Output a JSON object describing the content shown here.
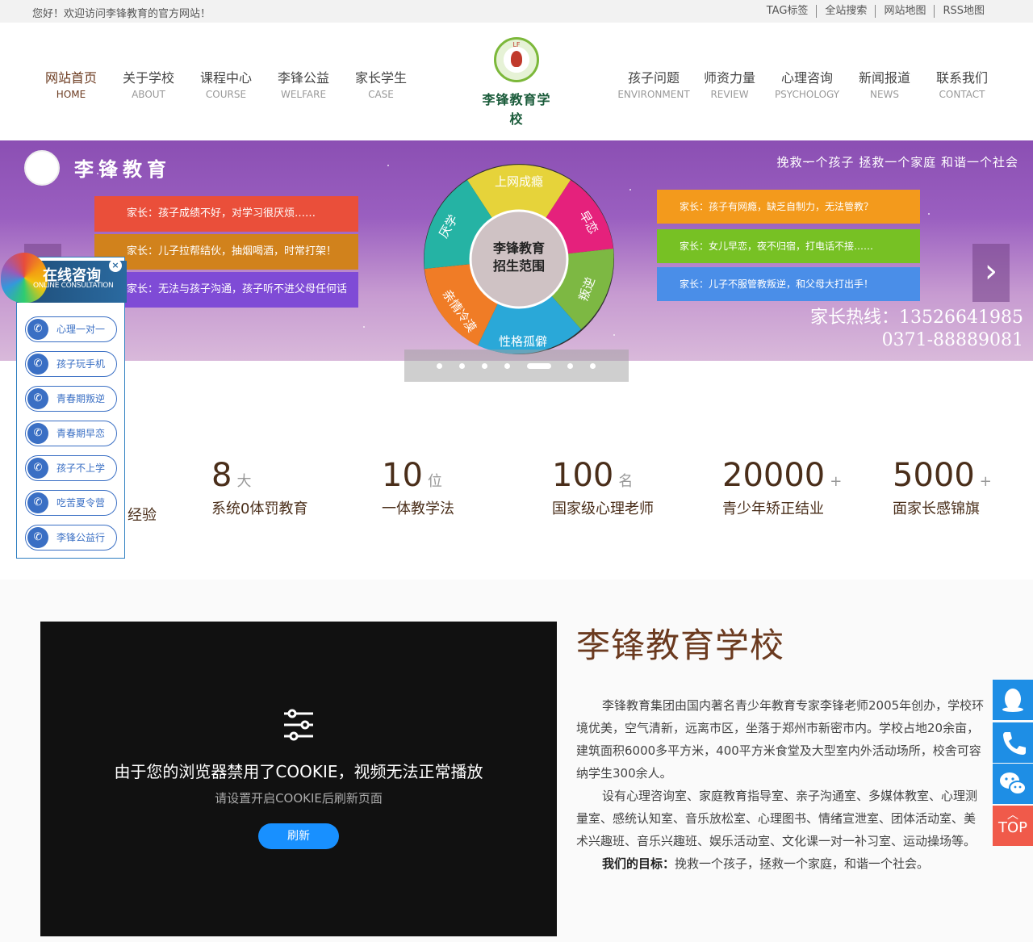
{
  "topbar": {
    "welcome": "您好！欢迎访问李锋教育的官方网站！",
    "links": [
      "TAG标签",
      "全站搜索",
      "网站地图",
      "RSS地图"
    ]
  },
  "nav": {
    "left": [
      {
        "cn": "网站首页",
        "en": "HOME"
      },
      {
        "cn": "关于学校",
        "en": "ABOUT"
      },
      {
        "cn": "课程中心",
        "en": "COURSE"
      },
      {
        "cn": "李锋公益",
        "en": "WELFARE"
      },
      {
        "cn": "家长学生",
        "en": "CASE"
      }
    ],
    "right": [
      {
        "cn": "孩子问题",
        "en": "ENVIRONMENT"
      },
      {
        "cn": "师资力量",
        "en": "REVIEW"
      },
      {
        "cn": "心理咨询",
        "en": "PSYCHOLOGY"
      },
      {
        "cn": "新闻报道",
        "en": "NEWS"
      },
      {
        "cn": "联系我们",
        "en": "CONTACT"
      }
    ],
    "logo_text": "李锋教育学校",
    "logo_mark": "LF"
  },
  "banner": {
    "brand": "李锋教育",
    "slogan": "挽救一个孩子 拯救一个家庭 和谐一个社会",
    "left_boxes": [
      "家长：孩子成绩不好，对学习很厌烦……",
      "家长：儿子拉帮结伙，抽烟喝酒，时常打架！",
      "家长：无法与孩子沟通，孩子听不进父母任何话"
    ],
    "right_boxes": [
      "家长：孩子有网瘾，缺乏自制力，无法管教？",
      "家长：女儿早恋，夜不归宿，打电话不接……",
      "家长：儿子不服管教叛逆，和父母大打出手！"
    ],
    "wheel_center": [
      "李锋教育",
      "招生范围"
    ],
    "wheel_segments": [
      "上网成瘾",
      "早恋",
      "叛逆",
      "性格孤僻",
      "亲情冷漠",
      "厌学"
    ],
    "hotline_label": "家长热线：",
    "hotline_1": "13526641985",
    "hotline_2": "0371-88889081",
    "slide_count": 7,
    "active_slide": 5
  },
  "stats": [
    {
      "num": "",
      "unit": "",
      "label": "经验"
    },
    {
      "num": "8",
      "unit": "大",
      "label": "系统0体罚教育"
    },
    {
      "num": "10",
      "unit": "位",
      "label": "一体教学法"
    },
    {
      "num": "100",
      "unit": "名",
      "label": "国家级心理老师"
    },
    {
      "num": "20000",
      "unit": "+",
      "label": "青少年矫正结业"
    },
    {
      "num": "5000",
      "unit": "+",
      "label": "面家长感锦旗"
    }
  ],
  "video": {
    "message": "由于您的浏览器禁用了COOKIE，视频无法正常播放",
    "sub": "请设置开启COOKIE后刷新页面",
    "button": "刷新"
  },
  "about": {
    "title": "李锋教育学校",
    "p1": "李锋教育集团由国内著名青少年教育专家李锋老师2005年创办，学校环境优美，空气清新，远离市区，坐落于郑州市新密市内。学校占地20余亩，建筑面积6000多平方米，400平方米食堂及大型室内外活动场所，校舍可容纳学生300余人。",
    "p2": "设有心理咨询室、家庭教育指导室、亲子沟通室、多媒体教室、心理测量室、感统认知室、音乐放松室、心理图书、情绪宣泄室、团体活动室、美术兴趣班、音乐兴趣班、娱乐活动室、文化课一对一补习室、运动操场等。",
    "goal_label": "我们的目标：",
    "goal_text": "挽救一个孩子，拯救一个家庭，和谐一个社会。"
  },
  "consult": {
    "title": "在线咨询",
    "subtitle": "ONLINE CONSULTATION",
    "close": "×",
    "items": [
      "心理一对一",
      "孩子玩手机",
      "青春期叛逆",
      "青春期早恋",
      "孩子不上学",
      "吃苦夏令营",
      "李锋公益行"
    ]
  },
  "sidebar": {
    "top_label": "TOP"
  },
  "colors": {
    "brand_brown": "#6b3a1f",
    "accent_blue": "#1e8ee5",
    "top_red": "#f05a4a"
  }
}
